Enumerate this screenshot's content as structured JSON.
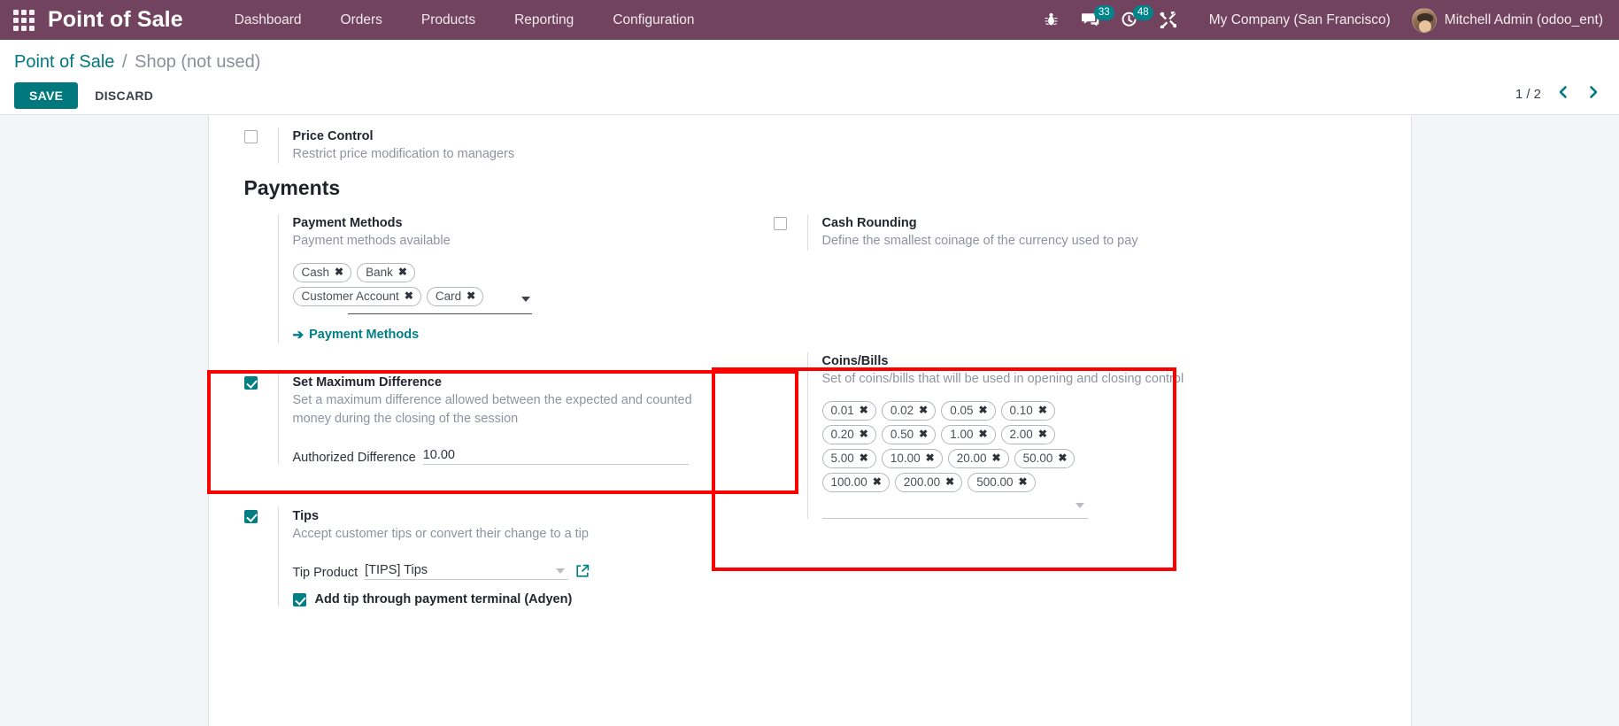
{
  "navbar": {
    "apps_icon": "apps-grid-icon",
    "brand": "Point of Sale",
    "menu": [
      {
        "label": "Dashboard"
      },
      {
        "label": "Orders"
      },
      {
        "label": "Products"
      },
      {
        "label": "Reporting"
      },
      {
        "label": "Configuration"
      }
    ],
    "sys_icons": [
      {
        "name": "bug-icon",
        "badge": ""
      },
      {
        "name": "messages-icon",
        "badge": "33"
      },
      {
        "name": "activities-clock-icon",
        "badge": "48"
      },
      {
        "name": "tools-icon",
        "badge": ""
      }
    ],
    "company": "My Company (San Francisco)",
    "user": "Mitchell Admin (odoo_ent)",
    "bg_color": "#71435f"
  },
  "control_panel": {
    "breadcrumb_root": "Point of Sale",
    "breadcrumb_separator": "/",
    "breadcrumb_current": "Shop (not used)",
    "save_label": "SAVE",
    "discard_label": "DISCARD",
    "pager_count": "1 / 2",
    "pager_prev": "‹",
    "pager_next": "›",
    "accent_color": "#00787d"
  },
  "settings": {
    "price_control": {
      "title": "Price Control",
      "desc": "Restrict price modification to managers",
      "checked": false
    },
    "payments_section_title": "Payments",
    "payment_methods": {
      "title": "Payment Methods",
      "desc": "Payment methods available",
      "tags": [
        "Cash",
        "Bank",
        "Customer Account",
        "Card"
      ],
      "tag_remove_glyph": "✖",
      "link_label": "Payment Methods",
      "link_arrow": "➔"
    },
    "cash_rounding": {
      "title": "Cash Rounding",
      "desc": "Define the smallest coinage of the currency used to pay",
      "checked": false
    },
    "set_maximum_difference": {
      "title": "Set Maximum Difference",
      "desc": "Set a maximum difference allowed between the expected and counted money during the closing of the session",
      "checked": true,
      "field_label": "Authorized Difference",
      "field_value": "10.00",
      "highlighted": true
    },
    "coins_bills": {
      "title": "Coins/Bills",
      "desc": "Set of coins/bills that will be used in opening and closing control",
      "tags": [
        "0.01",
        "0.02",
        "0.05",
        "0.10",
        "0.20",
        "0.50",
        "1.00",
        "2.00",
        "5.00",
        "10.00",
        "20.00",
        "50.00",
        "100.00",
        "200.00",
        "500.00"
      ],
      "tag_remove_glyph": "✖",
      "highlighted": true
    },
    "tips": {
      "title": "Tips",
      "desc": "Accept customer tips or convert their change to a tip",
      "checked": true,
      "field_label": "Tip Product",
      "field_value": "[TIPS] Tips",
      "sub_checkbox_label": "Add tip through payment terminal (Adyen)",
      "sub_checkbox_checked": true
    }
  },
  "annotation": {
    "color": "#ff0000"
  }
}
